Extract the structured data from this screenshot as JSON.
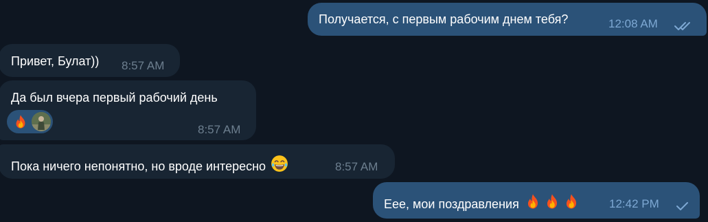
{
  "messages": [
    {
      "direction": "out",
      "text": "Получается, с первым рабочим днем тебя?",
      "time": "12:08 AM",
      "status": "read"
    },
    {
      "direction": "in",
      "text": "Привет, Булат))",
      "time": "8:57 AM"
    },
    {
      "direction": "in",
      "text": "Да был вчера первый рабочий день",
      "time": "8:57 AM",
      "reaction": {
        "emoji_icon": "fire-icon",
        "user": "avatar"
      }
    },
    {
      "direction": "in",
      "text": "Пока ничего непонятно, но вроде интересно",
      "emoji_icon": "joy-laughing-icon",
      "time": "8:57 AM"
    },
    {
      "direction": "out",
      "text": "Еее, мои поздравления",
      "emoji_icons": [
        "fire-icon",
        "fire-icon",
        "fire-icon"
      ],
      "time": "12:42 PM",
      "status": "sent"
    }
  ],
  "colors": {
    "background": "#0e1621",
    "incoming_bubble": "#182533",
    "outgoing_bubble": "#2b5278",
    "incoming_time": "#6d7f8f",
    "outgoing_time": "#7da8d3"
  }
}
